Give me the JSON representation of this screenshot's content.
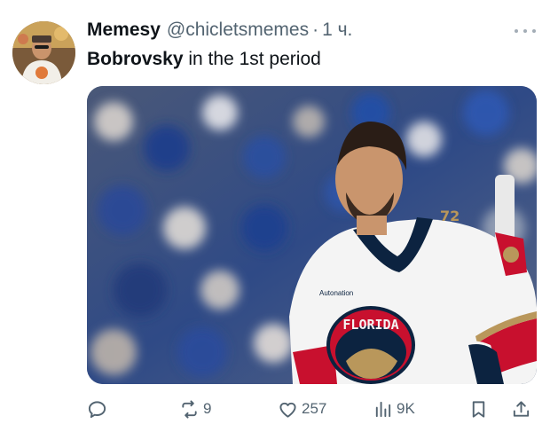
{
  "tweet": {
    "author_name": "Memesy",
    "handle": "@chicletsmemes",
    "separator": "·",
    "time": "1 ч.",
    "text_bold": "Bobrovsky",
    "text_rest": " in the 1st period"
  },
  "media": {
    "jersey_text": "FLORIDA",
    "jersey_number": "72",
    "sponsor": "Autonation"
  },
  "actions": {
    "reply_count": "",
    "retweet_count": "9",
    "like_count": "257",
    "views_count": "9K"
  },
  "colors": {
    "text_primary": "#0f1419",
    "text_secondary": "#536471",
    "jersey_red": "#c8102e",
    "jersey_gold": "#b9975b"
  },
  "icons": [
    "reply-icon",
    "retweet-icon",
    "like-icon",
    "views-icon",
    "bookmark-icon",
    "share-icon",
    "more-icon"
  ]
}
